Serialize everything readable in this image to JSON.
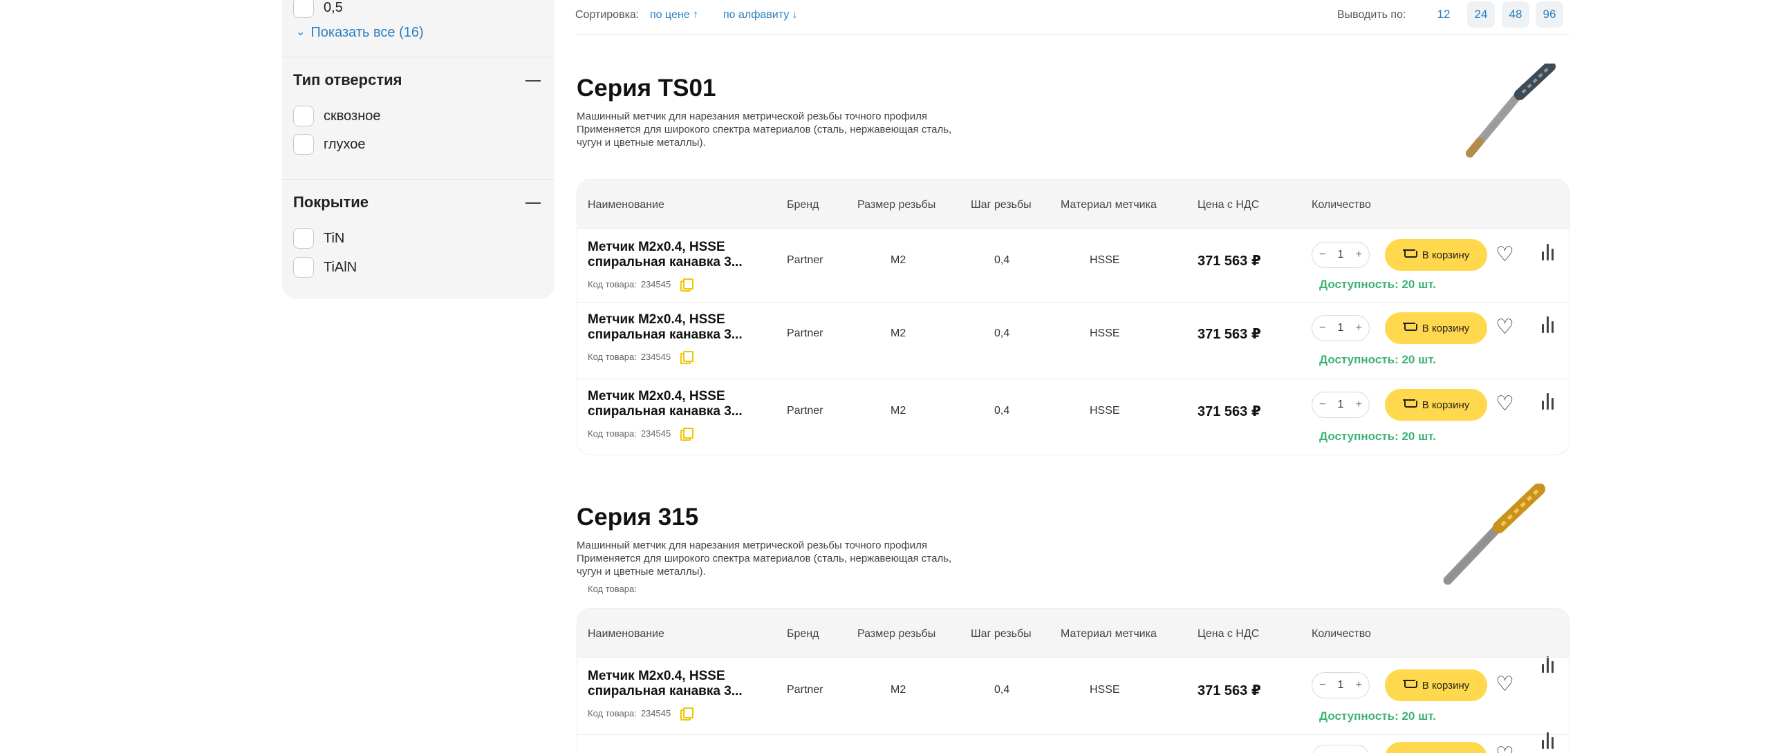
{
  "sidebar": {
    "prev_option": "0,5",
    "show_all": "Показать все (16)",
    "hole_type": {
      "title": "Тип отверстия",
      "options": [
        "сквозное",
        "глухое"
      ]
    },
    "coating": {
      "title": "Покрытие",
      "options": [
        "TiN",
        "TiAlN"
      ]
    }
  },
  "toolbar": {
    "sort_label": "Сортировка:",
    "sort_price": "по цене ↑",
    "sort_alpha": "по алфавиту ↓",
    "per_page_label": "Выводить по:",
    "per_page_options": [
      "12",
      "24",
      "48",
      "96"
    ]
  },
  "table_headers": {
    "name": "Наименование",
    "brand": "Бренд",
    "size": "Размер резьбы",
    "pitch": "Шаг резьбы",
    "material": "Материал метчика",
    "price": "Цена с НДС",
    "qty": "Количество"
  },
  "series": [
    {
      "title": "Серия TS01",
      "description": [
        "Машинный метчик для нарезания метрической резьбы точного профиля",
        "Применяется для широкого спектра материалов (сталь, нержавеющая сталь,",
        "чугун и цветные металлы)."
      ],
      "code_line": "",
      "rows": [
        {
          "name_1": "Метчик M2x0.4, HSSE",
          "name_2": "спиральная канавка 3...",
          "code_label": "Код товара:",
          "code": "234545",
          "brand": "Partner",
          "size": "M2",
          "pitch": "0,4",
          "material": "HSSE",
          "price": "371 563 ₽",
          "qty": "1",
          "cart": "В корзину",
          "avail": "Доступность: 20 шт."
        },
        {
          "name_1": "Метчик M2x0.4, HSSE",
          "name_2": "спиральная канавка 3...",
          "code_label": "Код товара:",
          "code": "234545",
          "brand": "Partner",
          "size": "M2",
          "pitch": "0,4",
          "material": "HSSE",
          "price": "371 563 ₽",
          "qty": "1",
          "cart": "В корзину",
          "avail": "Доступность: 20 шт."
        },
        {
          "name_1": "Метчик M2x0.4, HSSE",
          "name_2": "спиральная канавка 3...",
          "code_label": "Код товара:",
          "code": "234545",
          "brand": "Partner",
          "size": "M2",
          "pitch": "0,4",
          "material": "HSSE",
          "price": "371 563 ₽",
          "qty": "1",
          "cart": "В корзину",
          "avail": "Доступность: 20 шт."
        }
      ]
    },
    {
      "title": "Серия 315",
      "description": [
        "Машинный метчик для нарезания метрической резьбы точного профиля",
        "Применяется для широкого спектра материалов (сталь, нержавеющая сталь,",
        "чугун и цветные металлы)."
      ],
      "code_line": "Код товара:",
      "rows": [
        {
          "name_1": "Метчик M2x0.4, HSSE",
          "name_2": "спиральная канавка 3...",
          "code_label": "Код товара:",
          "code": "234545",
          "brand": "Partner",
          "size": "M2",
          "pitch": "0,4",
          "material": "HSSE",
          "price": "371 563 ₽",
          "qty": "1",
          "cart": "В корзину",
          "avail": "Доступность: 20 шт."
        }
      ]
    }
  ],
  "colors": {
    "accent_blue": "#2a7fc1",
    "cart_yellow": "#ffd84d",
    "availability_green": "#3cb371"
  }
}
